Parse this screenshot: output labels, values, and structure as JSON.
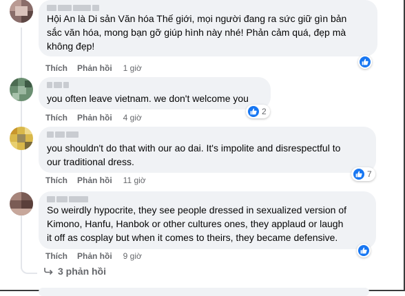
{
  "comments": [
    {
      "text_lines": [
        "Hội An là Di sản Văn hóa Thế giới, mọi người đang ra sức giữ gìn bản",
        "sắc văn hóa, mong bạn gỡ giúp hình này nhé! Phản cảm quá, đẹp mà",
        "không đẹp!"
      ],
      "like_label": "Thích",
      "reply_label": "Phản hồi",
      "time": "1 giờ",
      "reaction_count": ""
    },
    {
      "text_lines": [
        "you often leave vietnam. we don't welcome you"
      ],
      "like_label": "Thích",
      "reply_label": "Phản hồi",
      "time": "4 giờ",
      "reaction_count": "2"
    },
    {
      "text_lines": [
        "you shouldn't do that with our ao dai. It's impolite and disrespectful to",
        "our traditional dress."
      ],
      "like_label": "Thích",
      "reply_label": "Phản hồi",
      "time": "11 giờ",
      "reaction_count": "7"
    },
    {
      "text_lines": [
        "So weirdly hypocrite, they see people dressed in sexualized version of",
        "Kimono, Hanfu, Hanbok or other cultures ones, they applaud or laugh",
        "it off as cosplay but when it comes to theirs, they became defensive."
      ],
      "like_label": "Thích",
      "reply_label": "Phản hồi",
      "time": "9 giờ",
      "reaction_count": ""
    }
  ],
  "view_replies_label": "3 phản hồi",
  "colors": {
    "bubble": "#f0f2f5",
    "meta_text": "#65676b",
    "like_blue": "#1877f2",
    "text": "#050505"
  },
  "icons": {
    "reaction": "thumbs-up-icon",
    "replies": "reply-arrow-icon"
  }
}
